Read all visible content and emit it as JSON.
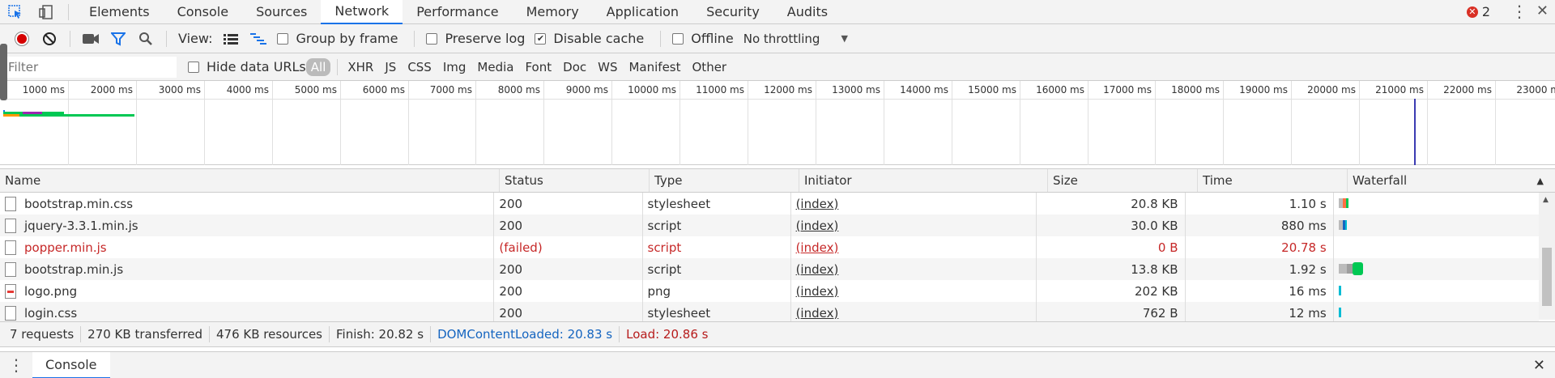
{
  "tabs": [
    {
      "label": "Elements"
    },
    {
      "label": "Console"
    },
    {
      "label": "Sources"
    },
    {
      "label": "Network"
    },
    {
      "label": "Performance"
    },
    {
      "label": "Memory"
    },
    {
      "label": "Application"
    },
    {
      "label": "Security"
    },
    {
      "label": "Audits"
    }
  ],
  "active_tab": "Network",
  "error_count": "2",
  "toolbar": {
    "view_label": "View:",
    "group_by_frame": "Group by frame",
    "preserve_log": "Preserve log",
    "disable_cache": "Disable cache",
    "offline": "Offline",
    "throttling": "No throttling"
  },
  "filter": {
    "placeholder": "Filter",
    "hide_data_urls": "Hide data URLs",
    "types": [
      "All",
      "XHR",
      "JS",
      "CSS",
      "Img",
      "Media",
      "Font",
      "Doc",
      "WS",
      "Manifest",
      "Other"
    ],
    "active_type": "All"
  },
  "overview": {
    "ticks": [
      "1000 ms",
      "2000 ms",
      "3000 ms",
      "4000 ms",
      "5000 ms",
      "6000 ms",
      "7000 ms",
      "8000 ms",
      "9000 ms",
      "10000 ms",
      "11000 ms",
      "12000 ms",
      "13000 ms",
      "14000 ms",
      "15000 ms",
      "16000 ms",
      "17000 ms",
      "18000 ms",
      "19000 ms",
      "20000 ms",
      "21000 ms",
      "22000 ms",
      "23000 m"
    ]
  },
  "table": {
    "headers": [
      "Name",
      "Status",
      "Type",
      "Initiator",
      "Size",
      "Time",
      "Waterfall"
    ],
    "rows": [
      {
        "name": "bootstrap.min.css",
        "status": "200",
        "type": "stylesheet",
        "initiator": "(index)",
        "size": "20.8 KB",
        "time": "1.10 s",
        "failed": false,
        "icon": "file-icon"
      },
      {
        "name": "jquery-3.3.1.min.js",
        "status": "200",
        "type": "script",
        "initiator": "(index)",
        "size": "30.0 KB",
        "time": "880 ms",
        "failed": false,
        "icon": "file-icon"
      },
      {
        "name": "popper.min.js",
        "status": "(failed)",
        "type": "script",
        "initiator": "(index)",
        "size": "0 B",
        "time": "20.78 s",
        "failed": true,
        "icon": "file-icon"
      },
      {
        "name": "bootstrap.min.js",
        "status": "200",
        "type": "script",
        "initiator": "(index)",
        "size": "13.8 KB",
        "time": "1.92 s",
        "failed": false,
        "icon": "file-icon"
      },
      {
        "name": "logo.png",
        "status": "200",
        "type": "png",
        "initiator": "(index)",
        "size": "202 KB",
        "time": "16 ms",
        "failed": false,
        "icon": "image-icon"
      },
      {
        "name": "login.css",
        "status": "200",
        "type": "stylesheet",
        "initiator": "(index)",
        "size": "762 B",
        "time": "12 ms",
        "failed": false,
        "icon": "file-icon"
      }
    ]
  },
  "summary": {
    "requests": "7 requests",
    "transferred": "270 KB transferred",
    "resources": "476 KB resources",
    "finish": "Finish: 20.82 s",
    "dom_content_loaded": "DOMContentLoaded: 20.83 s",
    "load": "Load: 20.86 s"
  },
  "drawer": {
    "tab": "Console"
  },
  "colors": {
    "accent": "#1a73e8",
    "error": "#d93025",
    "failed_text": "#c62828",
    "dcl_blue": "#1565c0",
    "load_red": "#b71c1c"
  }
}
